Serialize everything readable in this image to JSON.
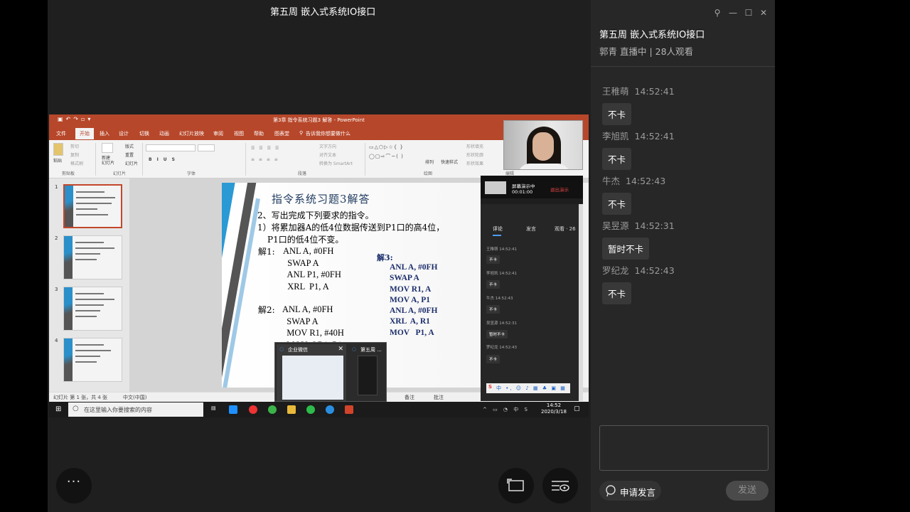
{
  "stage": {
    "title": "第五周 嵌入式系统IO接口"
  },
  "ppt": {
    "window_title": "第3章 指令系统习题3 解答 - PowerPoint",
    "menu": [
      "文件",
      "开始",
      "插入",
      "设计",
      "切换",
      "动画",
      "幻灯片放映",
      "审阅",
      "视图",
      "帮助",
      "图表堂"
    ],
    "tell_me": "告诉我你想要做什么",
    "ribbon_groups": [
      "剪贴板",
      "幻灯片",
      "字体",
      "段落",
      "绘图",
      "编辑"
    ],
    "ribbon_labels": {
      "paste": "粘贴",
      "cut": "剪切",
      "copy": "复制",
      "format": "格式刷",
      "new_slide": "新建\n幻灯片",
      "layout": "版式",
      "reset": "重置",
      "section": "节",
      "text_dir": "文字方向",
      "align": "对齐文本",
      "smartart": "转换为 SmartArt",
      "arrange": "排列",
      "quick_style": "快速样式",
      "fill": "形状填充",
      "outline": "形状轮廓",
      "effect": "形状效果"
    },
    "slide_numbers": [
      "1",
      "2",
      "3",
      "4"
    ],
    "slide": {
      "title": "指令系统习题3解答",
      "q_line1": "2、写出完成下列要求的指令。",
      "q_line2": "1）将累加器A的低4位数据传送到P1口的高4位，",
      "q_line3": "P1口的低4位不变。",
      "sol1_label": "解1:",
      "sol1_code": "ANL A, #0FH\n  SWAP A\n  ANL P1, #0FH\n  XRL  P1, A",
      "sol2_label": "解2:",
      "sol2_code": "ANL A, #0FH\n  SWAP A\n  MOV R1, #40H\n  MOV @R1, P1",
      "sol3_label": "解3:",
      "sol3_code": "ANL A, #0FH\nSWAP A\nMOV R1, A\nMOV A, P1\nANL A, #0FH\nXRL  A, R1\nMOV   P1, A"
    },
    "status": {
      "slide_info": "幻灯片 第 1 张，共 4 张",
      "lang": "中文(中国)",
      "notes": "备注",
      "comments": "批注"
    }
  },
  "taskbar": {
    "search_placeholder": "在这里输入你要搜索的内容",
    "time": "14:52",
    "date": "2020/3/18"
  },
  "preview": {
    "item1": "企业微信",
    "item2": "第五周 ..."
  },
  "mini_panel": {
    "share_status": "屏幕演示中",
    "share_time": "00:01:00",
    "stop": "退出演示",
    "tabs": [
      "评论",
      "发言",
      "观看 · 26"
    ],
    "messages": [
      {
        "name": "王稚萌",
        "time": "14:52:41",
        "text": "不卡"
      },
      {
        "name": "李旭凯",
        "time": "14:52:41",
        "text": "不卡"
      },
      {
        "name": "牛杰",
        "time": "14:52:43",
        "text": "不卡"
      },
      {
        "name": "吴昱源",
        "time": "14:52:31",
        "text": "暂时不卡"
      },
      {
        "name": "罗纪龙",
        "time": "14:52:43",
        "text": "不卡"
      }
    ]
  },
  "sidebar": {
    "title": "第五周 嵌入式系统IO接口",
    "subtitle": "郭青 直播中 | 28人观看",
    "messages": [
      {
        "name": "王稚萌",
        "time": "14:52:41",
        "text": "不卡"
      },
      {
        "name": "李旭凯",
        "time": "14:52:41",
        "text": "不卡"
      },
      {
        "name": "牛杰",
        "time": "14:52:43",
        "text": "不卡"
      },
      {
        "name": "吴昱源",
        "time": "14:52:31",
        "text": "暂时不卡"
      },
      {
        "name": "罗纪龙",
        "time": "14:52:43",
        "text": "不卡"
      }
    ],
    "apply_label": "申请发言",
    "send_label": "发送"
  },
  "controls": {
    "more": "···"
  },
  "colors": {
    "ppt_red": "#b7472a",
    "accent_blue": "#4c9bf5",
    "sidebar_bg": "#272727"
  }
}
